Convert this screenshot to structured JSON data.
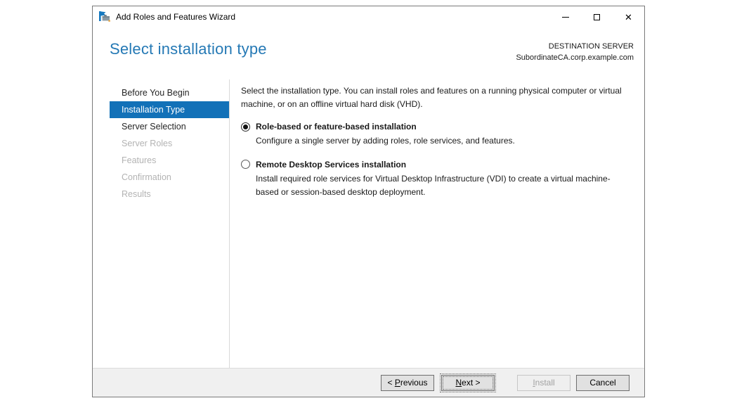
{
  "window": {
    "title": "Add Roles and Features Wizard"
  },
  "header": {
    "title": "Select installation type",
    "destination_label": "DESTINATION SERVER",
    "destination_server": "SubordinateCA.corp.example.com"
  },
  "sidebar": {
    "items": [
      {
        "label": "Before You Begin",
        "state": "enabled"
      },
      {
        "label": "Installation Type",
        "state": "selected"
      },
      {
        "label": "Server Selection",
        "state": "enabled"
      },
      {
        "label": "Server Roles",
        "state": "disabled"
      },
      {
        "label": "Features",
        "state": "disabled"
      },
      {
        "label": "Confirmation",
        "state": "disabled"
      },
      {
        "label": "Results",
        "state": "disabled"
      }
    ]
  },
  "content": {
    "intro": "Select the installation type. You can install roles and features on a running physical computer or virtual machine, or on an offline virtual hard disk (VHD).",
    "options": [
      {
        "label": "Role-based or feature-based installation",
        "description": "Configure a single server by adding roles, role services, and features.",
        "selected": true
      },
      {
        "label": "Remote Desktop Services installation",
        "description": "Install required role services for Virtual Desktop Infrastructure (VDI) to create a virtual machine-based or session-based desktop deployment.",
        "selected": false
      }
    ]
  },
  "footer": {
    "previous": {
      "pre": "< ",
      "key": "P",
      "post": "revious"
    },
    "next": {
      "pre": "",
      "key": "N",
      "post": "ext >"
    },
    "install": {
      "pre": "",
      "key": "I",
      "post": "nstall"
    },
    "cancel_label": "Cancel"
  },
  "colors": {
    "accent": "#1271b8",
    "heading": "#2579b5"
  }
}
